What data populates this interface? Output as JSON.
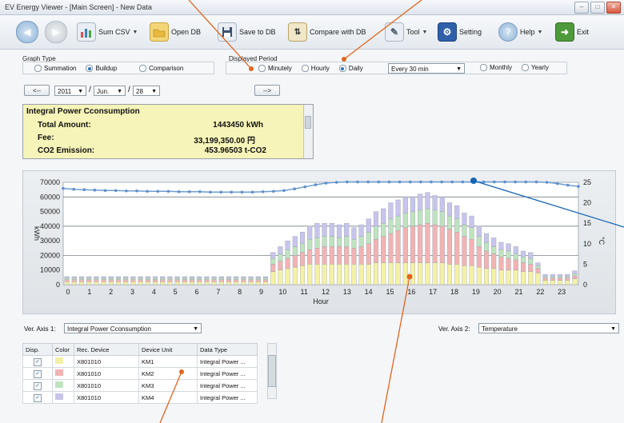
{
  "window": {
    "title": "EV Energy Viewer - [Main Screen] - New Data",
    "btn_min": "–",
    "btn_max": "□",
    "btn_close": "✕"
  },
  "toolbar": {
    "sum_csv": "Sum CSV",
    "open_db": "Open DB",
    "save_db": "Save to DB",
    "compare_db": "Compare with DB",
    "tool": "Tool",
    "setting": "Setting",
    "help": "Help",
    "exit": "Exit",
    "caret": "▼"
  },
  "graph_type": {
    "label": "Graph Type",
    "options": [
      "Summation",
      "Buildup",
      "Comparison"
    ],
    "selected": "Buildup"
  },
  "period": {
    "label": "Displayed Period",
    "options": [
      "Minutely",
      "Hourly",
      "Daily",
      "Monthly",
      "Yearly"
    ],
    "selected": "Daily",
    "interval": "Every 30 min"
  },
  "date": {
    "prev": "<--",
    "next": "-->",
    "year": "2011",
    "month": "Jun.",
    "day": "28",
    "sep": "/"
  },
  "summary": {
    "title": "Integral Power Cconsumption",
    "rows": [
      {
        "label": "Total Amount:",
        "value": "1443450 kWh"
      },
      {
        "label": "Fee:",
        "value": "33,199,350.00 円"
      },
      {
        "label": "CO2 Emission:",
        "value": "453.96503 t-CO2"
      }
    ]
  },
  "axis_select": {
    "axis1_label": "Ver. Axis 1:",
    "axis1_value": "Integral Power Cconsumption",
    "axis2_label": "Ver. Axis 2:",
    "axis2_value": "Temperature"
  },
  "device_table": {
    "headers": [
      "Disp.",
      "Color",
      "Rec. Device",
      "Device Unit",
      "Data Type"
    ],
    "rows": [
      {
        "disp": "✓",
        "color": "#f4f1a6",
        "device": "X801010",
        "unit": "KM1",
        "type": "Integral Power ..."
      },
      {
        "disp": "✓",
        "color": "#f2b3b3",
        "device": "X801010",
        "unit": "KM2",
        "type": "Integral Power ..."
      },
      {
        "disp": "✓",
        "color": "#bfe3bf",
        "device": "X801010",
        "unit": "KM3",
        "type": "Integral Power ..."
      },
      {
        "disp": "✓",
        "color": "#c7c5ec",
        "device": "X801010",
        "unit": "KM4",
        "type": "Integral Power ..."
      }
    ]
  },
  "chart_data": {
    "type": "bar",
    "stacked": true,
    "xlabel": "Hour",
    "ylabel": "kWh",
    "y2label": "°C",
    "ylim": [
      0,
      70000
    ],
    "y2lim": [
      0,
      25
    ],
    "yticks": [
      "0",
      "10000",
      "20000",
      "30000",
      "40000",
      "50000",
      "60000",
      "70000"
    ],
    "y2ticks": [
      "0",
      "5",
      "10",
      "15",
      "20",
      "25"
    ],
    "xticks": [
      "0",
      "1",
      "2",
      "3",
      "4",
      "5",
      "6",
      "7",
      "8",
      "9",
      "10",
      "11",
      "12",
      "13",
      "14",
      "15",
      "16",
      "17",
      "18",
      "19",
      "20",
      "21",
      "22",
      "23"
    ],
    "series": [
      {
        "name": "KM1",
        "color": "#f4f1a6",
        "values": [
          2000,
          2000,
          2000,
          2000,
          2000,
          2000,
          2000,
          2000,
          2000,
          2000,
          2000,
          2000,
          2000,
          2000,
          2000,
          2000,
          2000,
          2000,
          2000,
          2000,
          2000,
          2000,
          2000,
          2000,
          2000,
          2000,
          2000,
          2000,
          9000,
          10000,
          11000,
          12000,
          13000,
          14000,
          14000,
          14000,
          14000,
          14000,
          14000,
          14000,
          14000,
          14000,
          15000,
          15000,
          15000,
          15000,
          15000,
          15000,
          15000,
          15000,
          15000,
          15000,
          14000,
          14000,
          13000,
          13000,
          12000,
          11000,
          11000,
          10000,
          10000,
          10000,
          9000,
          9000,
          8000,
          3000,
          3000,
          3000,
          3000,
          4000
        ]
      },
      {
        "name": "KM2",
        "color": "#f2b3b3",
        "values": [
          1500,
          1500,
          1500,
          1500,
          1500,
          1500,
          1500,
          1500,
          1500,
          1500,
          1500,
          1500,
          1500,
          1500,
          1500,
          1500,
          1500,
          1500,
          1500,
          1500,
          1500,
          1500,
          1500,
          1500,
          1500,
          1500,
          1500,
          1500,
          5000,
          6000,
          7000,
          8000,
          9000,
          10000,
          11000,
          12000,
          12000,
          12000,
          12000,
          11000,
          12000,
          14000,
          16000,
          18000,
          20000,
          22000,
          24000,
          25000,
          26000,
          27000,
          26000,
          25000,
          24000,
          22000,
          20000,
          18000,
          14000,
          12000,
          10000,
          9000,
          8000,
          7000,
          6000,
          5000,
          3000,
          1500,
          1500,
          1500,
          1500,
          2000
        ]
      },
      {
        "name": "KM3",
        "color": "#bfe3bf",
        "values": [
          1000,
          1000,
          1000,
          1000,
          1000,
          1000,
          1000,
          1000,
          1000,
          1000,
          1000,
          1000,
          1000,
          1000,
          1000,
          1000,
          1000,
          1000,
          1000,
          1000,
          1000,
          1000,
          1000,
          1000,
          1000,
          1000,
          1000,
          1000,
          4000,
          5000,
          6000,
          6000,
          6000,
          7000,
          7000,
          7000,
          7000,
          6000,
          7000,
          6000,
          7000,
          8000,
          9000,
          9000,
          10000,
          10000,
          10000,
          10000,
          10000,
          10000,
          10000,
          10000,
          9000,
          9000,
          8000,
          8000,
          7000,
          6000,
          5000,
          5000,
          5000,
          4000,
          4000,
          4000,
          2000,
          1000,
          1000,
          1000,
          1000,
          1500
        ]
      },
      {
        "name": "KM4",
        "color": "#c7c5ec",
        "values": [
          1000,
          1000,
          1000,
          1000,
          1000,
          1000,
          1000,
          1000,
          1000,
          1000,
          1000,
          1000,
          1000,
          1000,
          1000,
          1000,
          1000,
          1000,
          1000,
          1000,
          1000,
          1000,
          1000,
          1000,
          1000,
          1000,
          1000,
          1000,
          4000,
          5000,
          6000,
          7000,
          8000,
          9000,
          10000,
          9000,
          9000,
          9000,
          9000,
          8000,
          8000,
          9000,
          10000,
          10000,
          11000,
          11000,
          11000,
          10000,
          11000,
          11000,
          10000,
          10000,
          9000,
          9000,
          8000,
          8000,
          7000,
          6000,
          6000,
          5000,
          5000,
          5000,
          4000,
          4000,
          2000,
          1500,
          1500,
          1500,
          1500,
          2000
        ]
      }
    ],
    "temperature": [
      23.5,
      23.3,
      23.2,
      23.1,
      23.0,
      23.0,
      22.9,
      22.9,
      22.8,
      22.8,
      22.8,
      22.7,
      22.7,
      22.7,
      22.6,
      22.6,
      22.6,
      22.6,
      22.6,
      22.7,
      22.8,
      23.0,
      23.4,
      23.9,
      24.4,
      24.8,
      25.0,
      25.1,
      25.1,
      25.1,
      25.1,
      25.1,
      25.1,
      25.1,
      25.1,
      25.1,
      25.1,
      25.1,
      25.1,
      25.1,
      25.1,
      25.1,
      25.1,
      25.1,
      25.1,
      25.1,
      25.0,
      24.7,
      24.3,
      24.0
    ],
    "grid": true
  }
}
